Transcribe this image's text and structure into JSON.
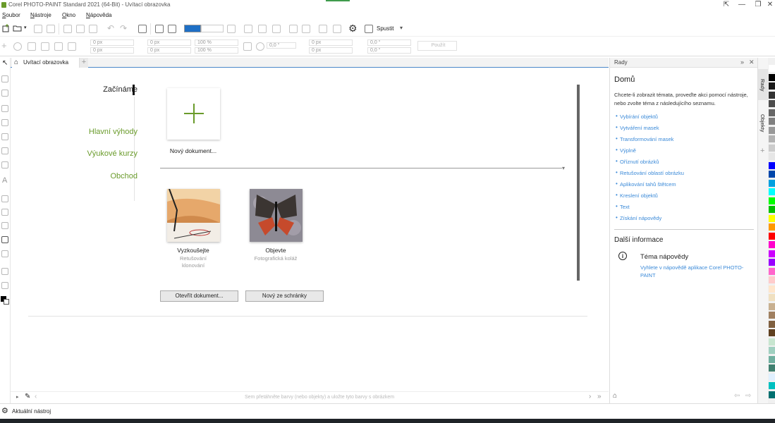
{
  "window": {
    "title": "Corel PHOTO-PAINT Standard 2021 (64-Bit) - Uvítací obrazovka",
    "controls": [
      "⇱",
      "—",
      "❐",
      "✕"
    ]
  },
  "menu": {
    "items": [
      {
        "pre": "S",
        "rest": "oubor"
      },
      {
        "pre": "N",
        "rest": "ástroje"
      },
      {
        "pre": "O",
        "rest": "kno"
      },
      {
        "pre": "N",
        "rest": "ápověda"
      }
    ]
  },
  "toolbar": {
    "launch_label": "Spustit",
    "fields": {
      "x1": "0 px",
      "x2": "0 px",
      "w1": "0 px",
      "w2": "0 px",
      "p1": "100 %",
      "p2": "100 %",
      "angle": "0,0 °",
      "c1": "0 px",
      "c2": "0 px",
      "s1": "0,0 °",
      "s2": "0,0 °",
      "apply": "Použít"
    }
  },
  "doc_tab": {
    "label": "Uvítací obrazovka"
  },
  "welcome": {
    "nav": {
      "getting_started": "Začínáme",
      "highlights": "Hlavní výhody",
      "tutorials": "Výukové kurzy",
      "store": "Obchod"
    },
    "new_document": "Nový dokument...",
    "templates": [
      {
        "title": "Vyzkoušejte",
        "subtitle": "Retušování klonování"
      },
      {
        "title": "Objevte",
        "subtitle": "Fotografická koláž"
      }
    ],
    "open_button": "Otevřít dokument...",
    "clipboard_button": "Nový ze schránky"
  },
  "doc_status": {
    "hint": "Sem přetáhněte barvy (nebo objekty) a uložte tyto barvy s obrázkem"
  },
  "hints_panel": {
    "header": "Rady",
    "home_title": "Domů",
    "intro": "Chcete-li zobrazit témata, proveďte akci pomocí nástroje, nebo zvolte téma z následujícího seznamu.",
    "links": [
      "Vybírání objektů",
      "Vytváření masek",
      "Transformování masek",
      "Výplně",
      "Oříznutí obrázků",
      "Retušování oblastí obrázku",
      "Aplikování tahů štětcem",
      "Kreslení objektů",
      "Text",
      "Získání nápovědy"
    ],
    "more_title": "Další informace",
    "topic_title": "Téma nápovědy",
    "topic_link": "Vyhlete v nápovědě aplikace Corel PHOTO-PAINT"
  },
  "side_tabs": {
    "hints": "Rady",
    "objects": "Objekty"
  },
  "status": {
    "active_tool": "Aktuální nástroj"
  },
  "colors": {
    "accent_green": "#6a9b2b",
    "link_blue": "#3b8ad8",
    "palette": [
      "#ffffff",
      "#000000",
      "#1a1a1a",
      "#333333",
      "#4d4d4d",
      "#666666",
      "#808080",
      "#999999",
      "#b3b3b3",
      "#cccccc",
      "#e6e6e6",
      "#0000ff",
      "#0047ab",
      "#00a0e0",
      "#00ffff",
      "#00ff00",
      "#00c000",
      "#ffff00",
      "#ff9900",
      "#ff0000",
      "#ff00cc",
      "#cc00ff",
      "#9900ff",
      "#ff66cc",
      "#ffcccc",
      "#ffe6cc",
      "#f0e0c0",
      "#c8b090",
      "#a08060",
      "#806040",
      "#604020",
      "#c8e6d0",
      "#a0d0c0",
      "#70b0a0",
      "#408070",
      "#e0f0ff",
      "#00c0c0",
      "#007070"
    ]
  }
}
